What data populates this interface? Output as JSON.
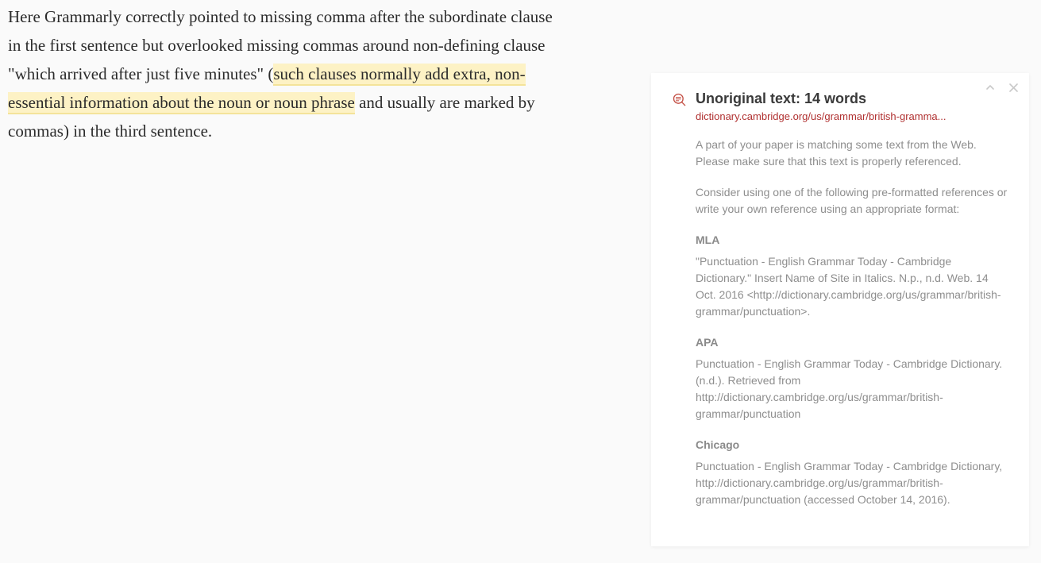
{
  "article": {
    "pre": "Here Grammarly correctly pointed to missing comma after the subordinate clause in the first sentence but overlooked missing commas around non-defining clause \"which arrived after just five minutes\" (",
    "highlight": "such clauses normally add extra, non-essential information about the noun or noun phrase",
    "post": " and usually are marked by commas) in the third sentence."
  },
  "card": {
    "title": "Unoriginal text: 14 words",
    "source": "dictionary.cambridge.org/us/grammar/british-gramma...",
    "warning": "A part of your paper is matching some text from the Web. Please make sure that this text is properly referenced.",
    "suggestion": "Consider using one of the following pre-formatted references or write your own reference using an appropriate format:",
    "refs": {
      "mla_label": "MLA",
      "mla_text": "\"Punctuation - English Grammar Today - Cambridge Dictionary.\" Insert Name of Site in Italics. N.p., n.d. Web. 14 Oct. 2016 <http://dictionary.cambridge.org/us/grammar/british-grammar/punctuation>.",
      "apa_label": "APA",
      "apa_text": "Punctuation - English Grammar Today - Cambridge Dictionary. (n.d.). Retrieved from http://dictionary.cambridge.org/us/grammar/british-grammar/punctuation",
      "chicago_label": "Chicago",
      "chicago_text": "Punctuation - English Grammar Today - Cambridge Dictionary, http://dictionary.cambridge.org/us/grammar/british-grammar/punctuation (accessed October 14, 2016)."
    }
  }
}
